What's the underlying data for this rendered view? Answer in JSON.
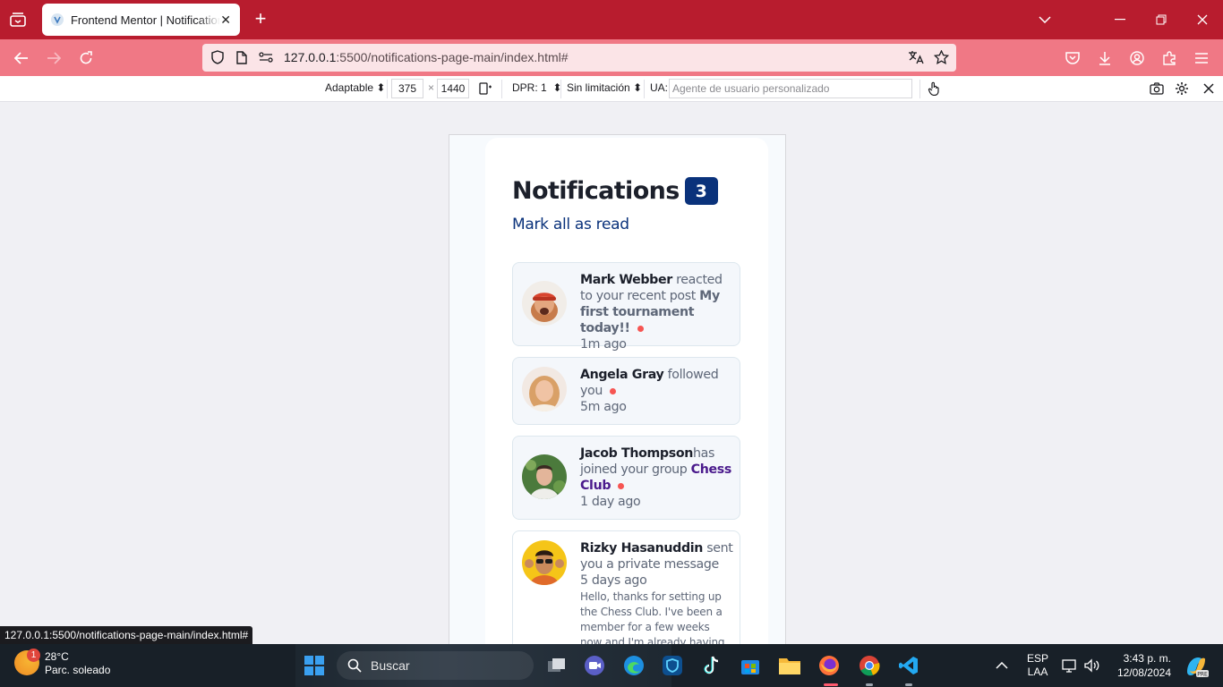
{
  "browser": {
    "tab_title": "Frontend Mentor | Notifications page",
    "url_host": "127.0.0.1",
    "url_rest": ":5500/notifications-page-main/index.html#",
    "status_url": "127.0.0.1:5500/notifications-page-main/index.html#"
  },
  "rdm": {
    "device": "Adaptable",
    "width": "375",
    "times": "×",
    "height": "1440",
    "dpr": "DPR: 1",
    "throttle": "Sin limitación",
    "ua_label": "UA:",
    "ua_placeholder": "Agente de usuario personalizado"
  },
  "page": {
    "title": "Notifications",
    "unread_count": "3",
    "mark_all": "Mark all as read",
    "notifications": [
      {
        "actor": "Mark Webber",
        "action": "reacted to your recent post",
        "target": "My first tournament today!!",
        "unread": true,
        "time": "1m ago"
      },
      {
        "actor": "Angela Gray",
        "action": "followed you",
        "unread": true,
        "time": "5m ago"
      },
      {
        "actor": "Jacob Thompson",
        "action": "has joined your group",
        "target": "Chess Club",
        "unread": true,
        "time": "1 day ago"
      },
      {
        "actor": "Rizky Hasanuddin",
        "action": "sent you a private message",
        "time": "5 days ago",
        "message": "Hello, thanks for setting up the Chess Club. I've been a member for a few weeks now and I'm already having lots of"
      }
    ]
  },
  "taskbar": {
    "temp": "28°C",
    "weather": "Parc. soleado",
    "weather_badge": "1",
    "search": "Buscar",
    "lang": "ESP",
    "layout": "LAA",
    "time": "3:43 p. m.",
    "date": "12/08/2024"
  },
  "colors": {
    "tabbar": "#b81c2e",
    "navbar": "#f07885",
    "badge": "#0a327b",
    "unread_dot": "#f65552"
  }
}
